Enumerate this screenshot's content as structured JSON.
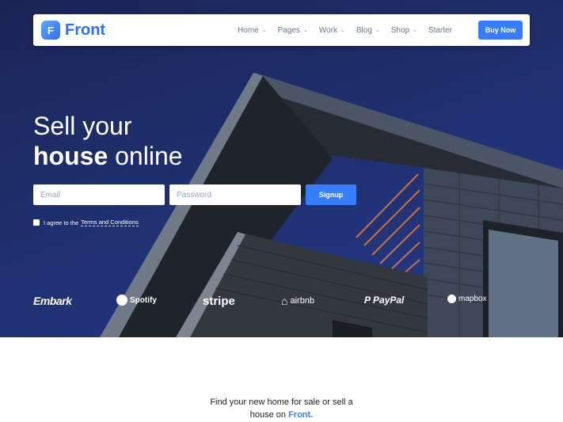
{
  "nav": {
    "logo_letter": "F",
    "logo_text": "Front",
    "items": [
      {
        "label": "Home",
        "has_dropdown": true
      },
      {
        "label": "Pages",
        "has_dropdown": true
      },
      {
        "label": "Work",
        "has_dropdown": true
      },
      {
        "label": "Blog",
        "has_dropdown": true
      },
      {
        "label": "Shop",
        "has_dropdown": true
      },
      {
        "label": "Starter",
        "has_dropdown": false
      }
    ],
    "chevron": "⌄",
    "buy_label": "Buy Now"
  },
  "hero": {
    "line1": "Sell your",
    "line2_bold": "house",
    "line2_rest": "online",
    "email_placeholder": "Email",
    "password_placeholder": "Password",
    "signup_label": "Signup",
    "agree_text": "I agree to the",
    "terms_text": "Terms and Conditions"
  },
  "brands": [
    "Embark",
    "Spotify",
    "stripe",
    "airbnb",
    "PayPal",
    "mapbox"
  ],
  "section": {
    "line1": "Find your new home for sale or sell a",
    "line2_pre": "house on",
    "line2_brand": "Front."
  },
  "colors": {
    "accent": "#377dff",
    "hero_bg": "#1f2f6e"
  }
}
